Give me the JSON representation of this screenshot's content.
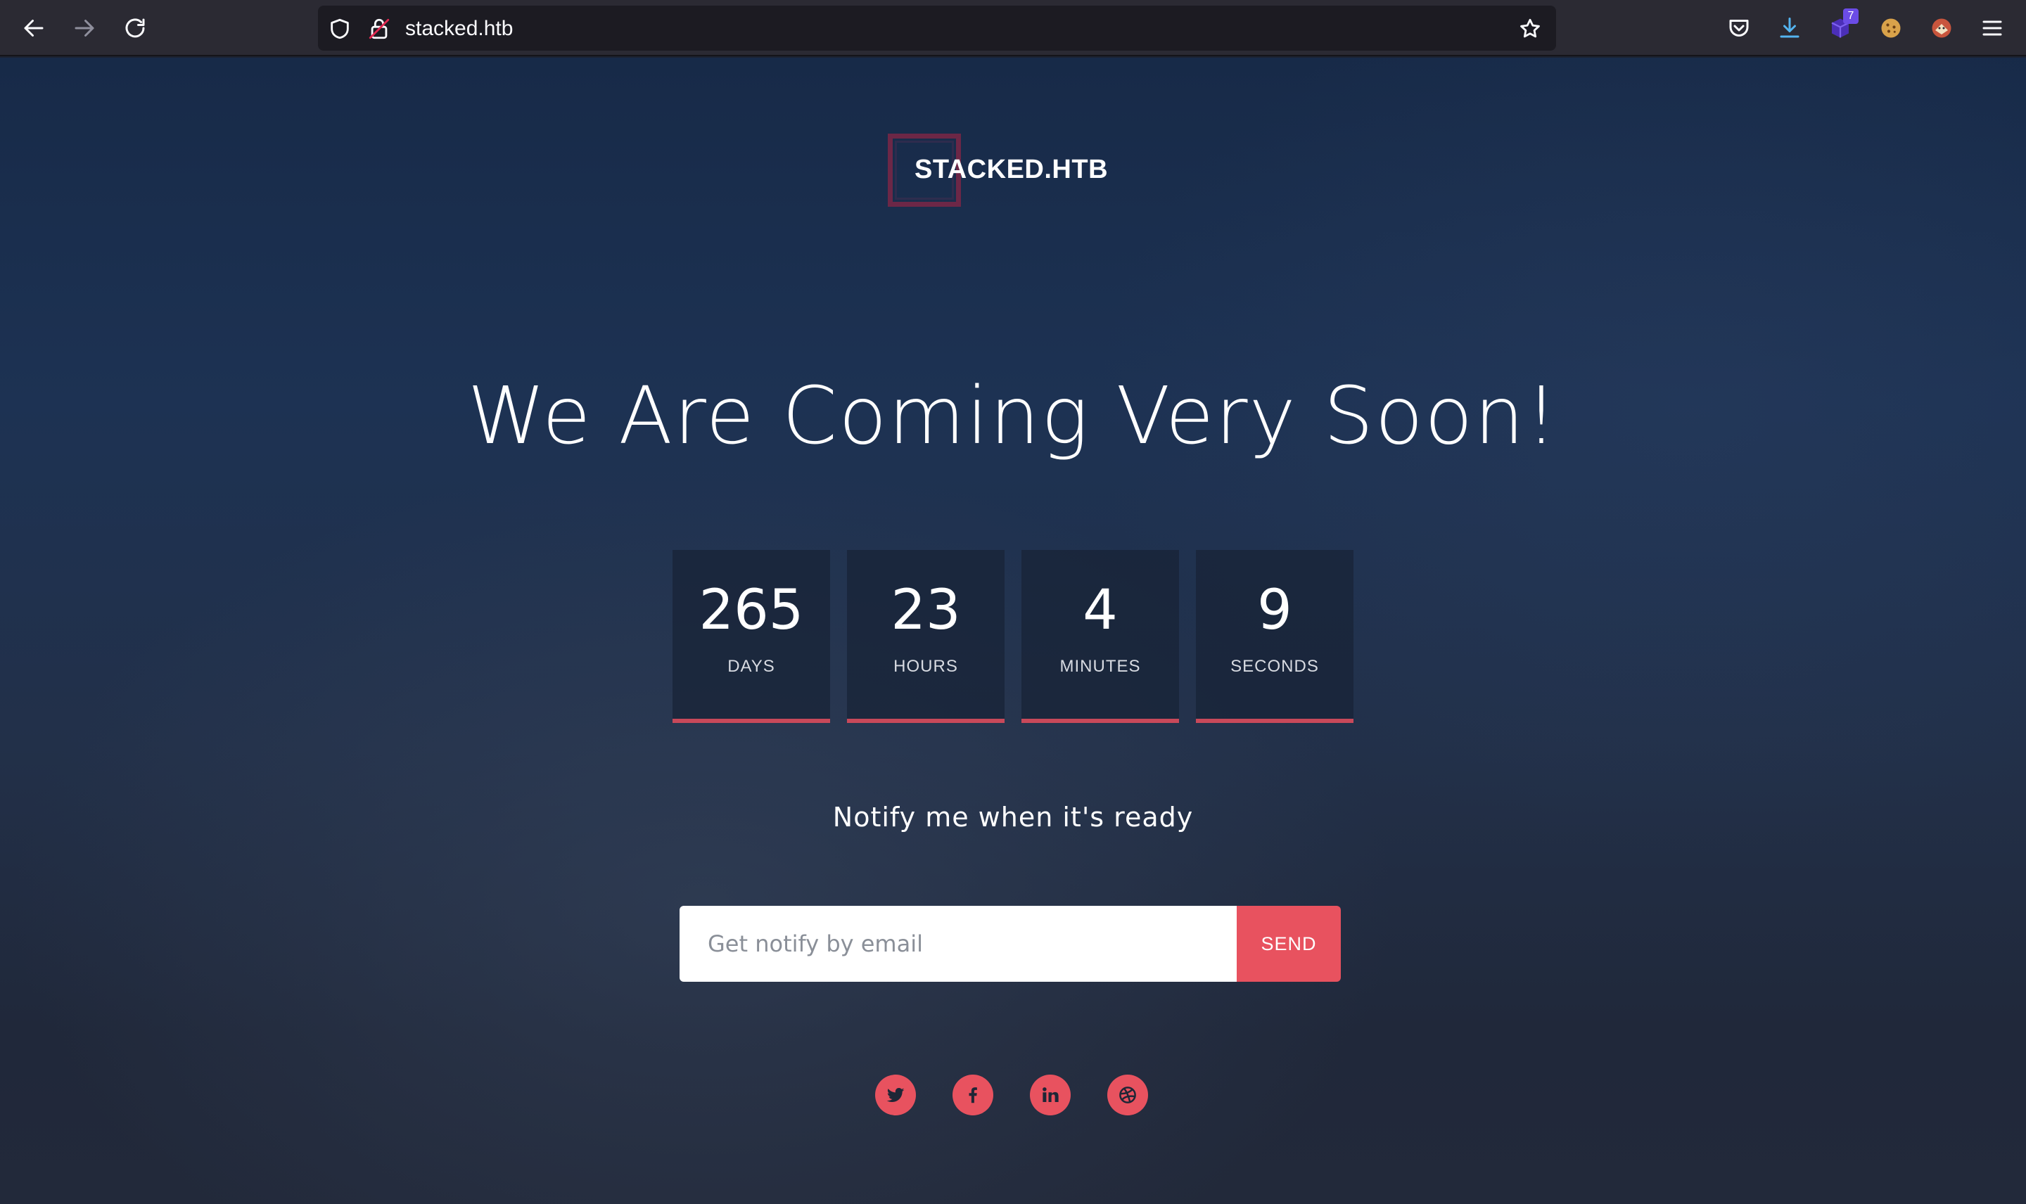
{
  "browser": {
    "url": "stacked.htb",
    "extension_badge": "7"
  },
  "page": {
    "logo_text": "STACKED.HTB",
    "headline": "We Are Coming Very Soon!",
    "countdown": [
      {
        "value": "265",
        "label": "DAYS"
      },
      {
        "value": "23",
        "label": "HOURS"
      },
      {
        "value": "4",
        "label": "MINUTES"
      },
      {
        "value": "9",
        "label": "SECONDS"
      }
    ],
    "notify_text": "Notify me when it's ready",
    "email_placeholder": "Get notify by email",
    "send_label": "SEND",
    "socials": [
      "twitter-icon",
      "facebook-icon",
      "linkedin-icon",
      "dribbble-icon"
    ]
  },
  "colors": {
    "accent": "#e8525f",
    "toolbar": "#2b2a33",
    "urlbar": "#1c1b22"
  }
}
